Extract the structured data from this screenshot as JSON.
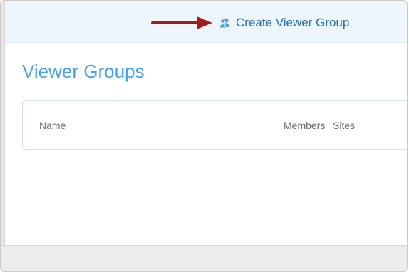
{
  "header": {
    "create_group_label": "Create Viewer Group",
    "create_group_icon": "users-icon"
  },
  "main": {
    "title": "Viewer Groups"
  },
  "table": {
    "columns": [
      "Name",
      "Members",
      "Sites"
    ]
  },
  "colors": {
    "accent": "#4aa3e8",
    "link": "#2a6fb3",
    "annotation_arrow": "#a51b1b",
    "topbar_bg": "#eef6fd"
  }
}
